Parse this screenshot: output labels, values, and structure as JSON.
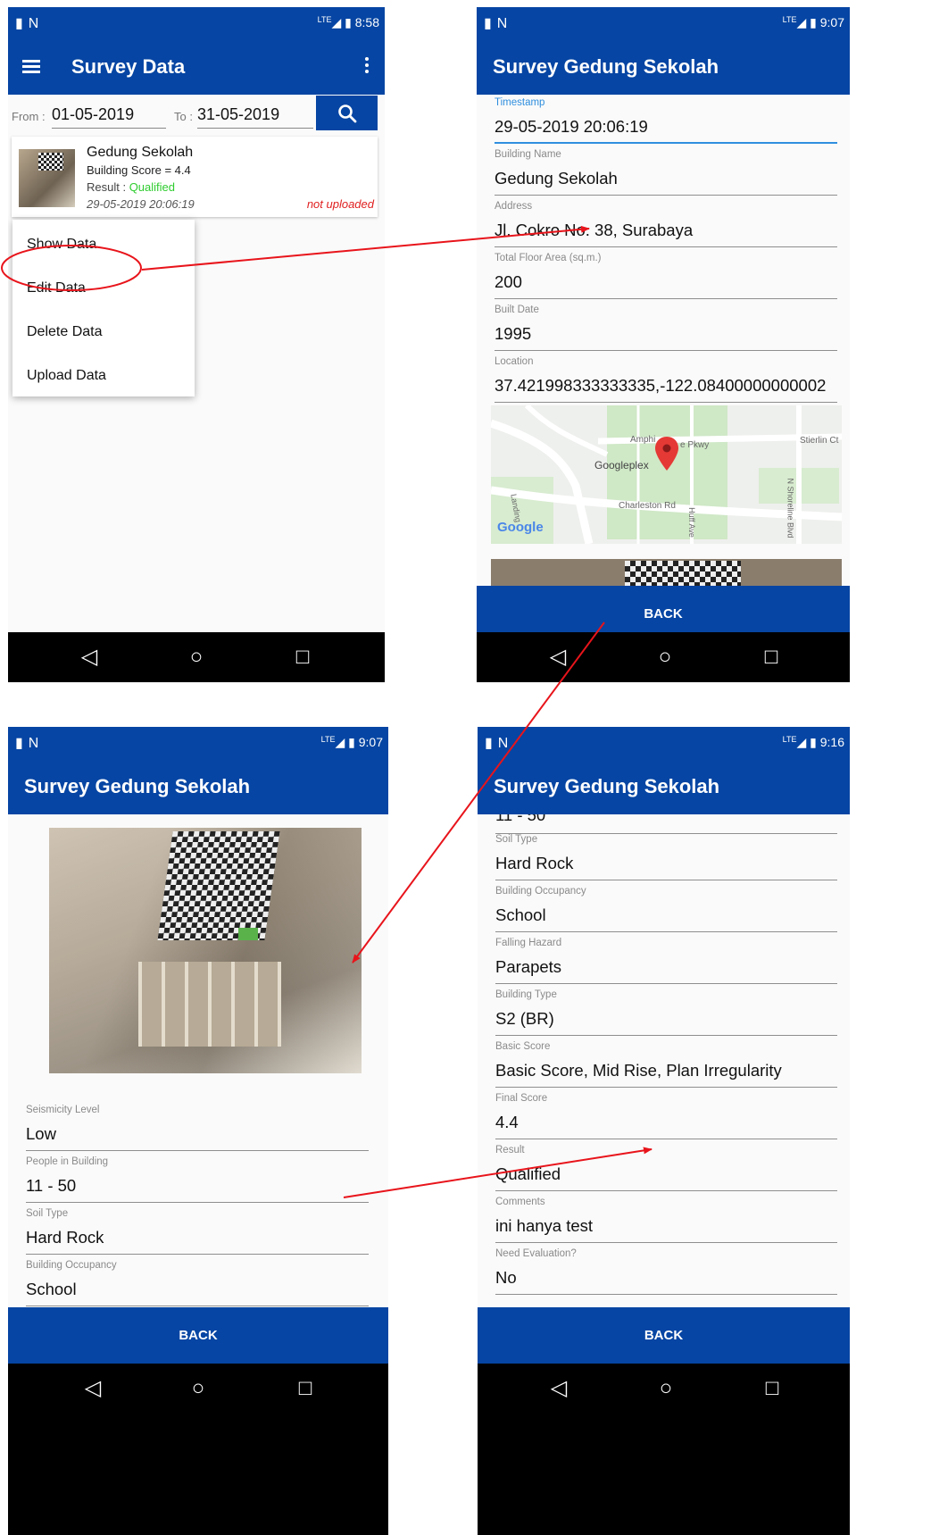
{
  "status_times": [
    "8:58",
    "9:07",
    "9:07",
    "9:16"
  ],
  "list_screen": {
    "title": "Survey Data",
    "from_label": "From :",
    "from_value": "01-05-2019",
    "to_label": "To :",
    "to_value": "31-05-2019",
    "item": {
      "name": "Gedung Sekolah",
      "score": "Building Score = 4.4",
      "result_label": "Result : ",
      "result_value": "Qualified",
      "timestamp": "29-05-2019 20:06:19",
      "upload_status": "not uploaded"
    },
    "menu": [
      "Show Data",
      "Edit Data",
      "Delete Data",
      "Upload Data"
    ]
  },
  "detail_title": "Survey Gedung Sekolah",
  "back_label": "BACK",
  "detail_top_fields": [
    {
      "label": "Timestamp",
      "value": "29-05-2019 20:06:19"
    },
    {
      "label": "Building Name",
      "value": "Gedung Sekolah"
    },
    {
      "label": "Address",
      "value": "Jl. Cokro No. 38, Surabaya"
    },
    {
      "label": "Total Floor Area (sq.m.)",
      "value": "200"
    },
    {
      "label": "Built Date",
      "value": "1995"
    },
    {
      "label": "Location",
      "value": "37.421998333333335,-122.08400000000002"
    }
  ],
  "map_labels": {
    "googleplex": "Googleplex",
    "amph": "Amphi",
    "pkwy": "e Pkwy",
    "charleston": "Charleston Rd",
    "huff": "Huff Ave",
    "stierlin": "Stierlin Ct",
    "shoreline": "N Shoreline Blvd",
    "landing": "Landing",
    "google": "Google"
  },
  "photo_screen_fields": [
    {
      "label": "Seismicity Level",
      "value": "Low"
    },
    {
      "label": "People in Building",
      "value": "11 - 50"
    },
    {
      "label": "Soil Type",
      "value": "Hard Rock"
    },
    {
      "label": "Building Occupancy",
      "value": "School"
    }
  ],
  "final_screen_partial_value": "11 - 50",
  "final_screen_fields": [
    {
      "label": "Soil Type",
      "value": "Hard Rock"
    },
    {
      "label": "Building Occupancy",
      "value": "School"
    },
    {
      "label": "Falling Hazard",
      "value": "Parapets"
    },
    {
      "label": "Building Type",
      "value": "S2 (BR)"
    },
    {
      "label": "Basic Score",
      "value": "Basic Score, Mid Rise, Plan Irregularity"
    },
    {
      "label": "Final Score",
      "value": "4.4"
    },
    {
      "label": "Result",
      "value": "Qualified"
    },
    {
      "label": "Comments",
      "value": "ini hanya test"
    },
    {
      "label": "Need Evaluation?",
      "value": "No"
    }
  ],
  "colors": {
    "primary": "#0645a3",
    "qualified": "#2ecc2e",
    "not_uploaded": "#e02020",
    "annotation": "#e8141b",
    "active_field": "#2f8ede"
  },
  "icons": [
    "menu-icon",
    "more-vert-icon",
    "search-icon",
    "back-triangle-icon",
    "home-circle-icon",
    "recents-square-icon",
    "map-pin-icon"
  ]
}
